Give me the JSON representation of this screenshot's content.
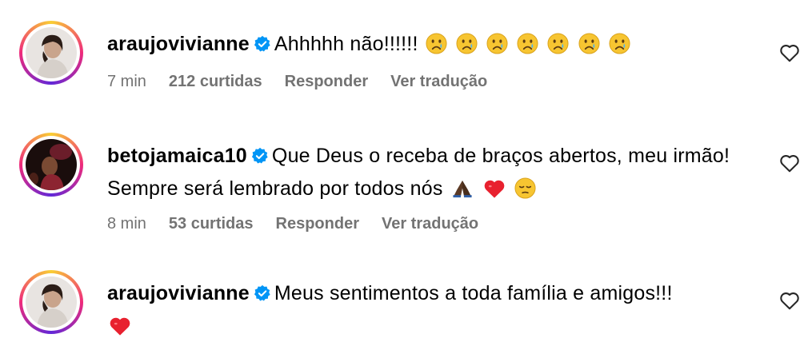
{
  "comments": [
    {
      "username": "araujovivianne",
      "text": "Ahhhhh não!!!!!!",
      "time": "7 min",
      "likes": "212 curtidas",
      "reply_label": "Responder",
      "translate_label": "Ver tradução"
    },
    {
      "username": "betojamaica10",
      "text": "Que Deus o receba de braços abertos, meu irmão! Sempre será lembrado por todos nós",
      "time": "8 min",
      "likes": "53 curtidas",
      "reply_label": "Responder",
      "translate_label": "Ver tradução"
    },
    {
      "username": "araujovivianne",
      "text": "Meus sentimentos a toda família e amigos!!!"
    }
  ],
  "colors": {
    "verified": "#0095f6",
    "meta_text": "#737373",
    "heart_emoji": "#e8212f",
    "emoji_face": "#f7c531"
  },
  "icons": {
    "verified": "verified-badge-icon",
    "like": "heart-outline-icon"
  }
}
